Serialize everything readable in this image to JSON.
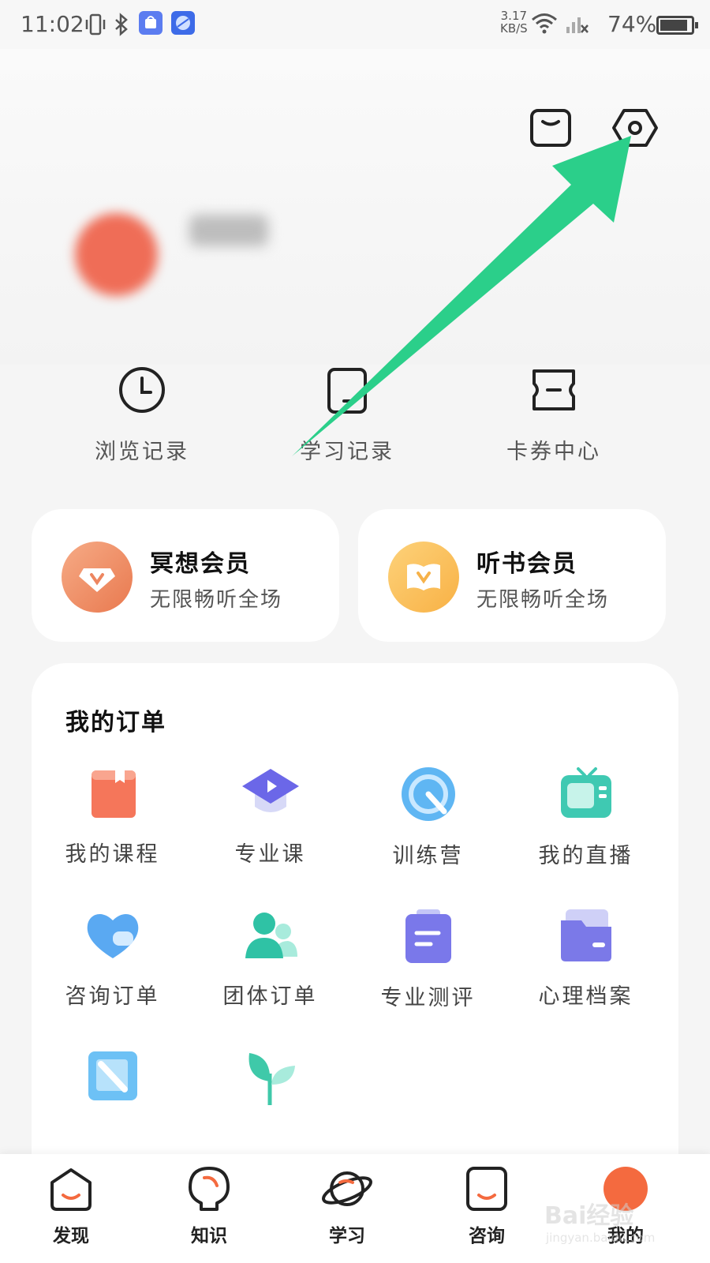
{
  "status_bar": {
    "time": "11:02",
    "speed_value": "3.17",
    "speed_unit": "KB/S",
    "battery": "74%",
    "icons": [
      "vibrate-icon",
      "bluetooth-icon",
      "app-notification-icon",
      "browser-notification-icon",
      "wifi-icon",
      "signal-icon",
      "battery-icon"
    ]
  },
  "header": {
    "icons": [
      "message-icon",
      "settings-icon"
    ]
  },
  "quick_links": [
    {
      "label": "浏览记录",
      "icon": "clock-icon"
    },
    {
      "label": "学习记录",
      "icon": "study-record-icon"
    },
    {
      "label": "卡券中心",
      "icon": "coupon-icon"
    }
  ],
  "memberships": [
    {
      "title": "冥想会员",
      "subtitle": "无限畅听全场",
      "icon": "meditation-vip-icon",
      "color": "#f0926b"
    },
    {
      "title": "听书会员",
      "subtitle": "无限畅听全场",
      "icon": "audiobook-vip-icon",
      "color": "#fbc25f"
    }
  ],
  "orders": {
    "title": "我的订单",
    "items": [
      {
        "label": "我的课程",
        "icon": "course-book-icon"
      },
      {
        "label": "专业课",
        "icon": "graduation-cap-icon"
      },
      {
        "label": "训练营",
        "icon": "training-camp-icon"
      },
      {
        "label": "我的直播",
        "icon": "tv-live-icon"
      },
      {
        "label": "咨询订单",
        "icon": "consult-heart-icon"
      },
      {
        "label": "团体订单",
        "icon": "group-icon"
      },
      {
        "label": "专业测评",
        "icon": "clipboard-icon"
      },
      {
        "label": "心理档案",
        "icon": "folder-icon"
      },
      {
        "label": "",
        "icon": "pen-icon"
      },
      {
        "label": "",
        "icon": "sprout-icon"
      }
    ]
  },
  "nav": [
    {
      "label": "发现",
      "icon": "discover-icon"
    },
    {
      "label": "知识",
      "icon": "lightbulb-icon"
    },
    {
      "label": "学习",
      "icon": "planet-icon"
    },
    {
      "label": "咨询",
      "icon": "consult-icon"
    },
    {
      "label": "我的",
      "icon": "profile-icon",
      "active": true
    }
  ],
  "watermark": {
    "main": "Bai经验",
    "sub": "jingyan.baidu.com"
  },
  "colors": {
    "arrow": "#2bcf8a",
    "accent": "#f46a3f"
  }
}
